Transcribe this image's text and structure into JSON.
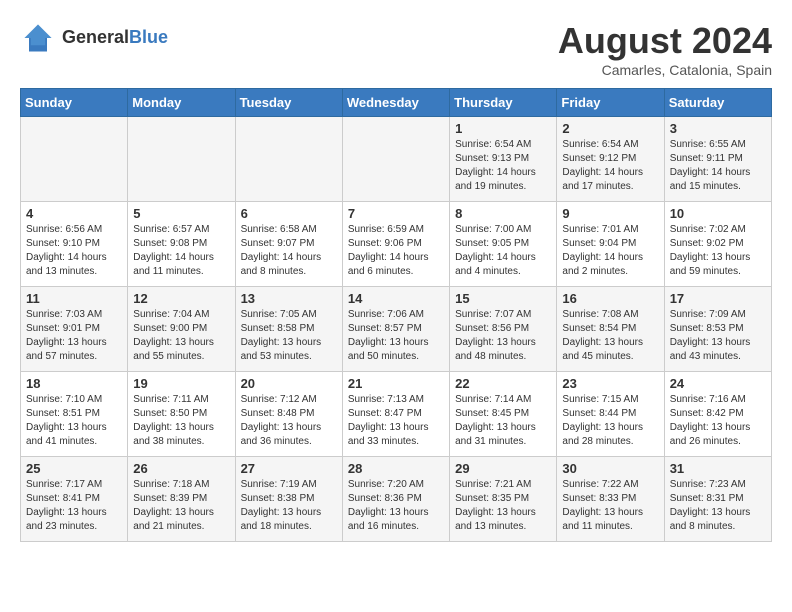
{
  "header": {
    "logo": {
      "general": "General",
      "blue": "Blue"
    },
    "title": "August 2024",
    "location": "Camarles, Catalonia, Spain"
  },
  "days_of_week": [
    "Sunday",
    "Monday",
    "Tuesday",
    "Wednesday",
    "Thursday",
    "Friday",
    "Saturday"
  ],
  "weeks": [
    [
      {
        "day": "",
        "info": ""
      },
      {
        "day": "",
        "info": ""
      },
      {
        "day": "",
        "info": ""
      },
      {
        "day": "",
        "info": ""
      },
      {
        "day": "1",
        "info": "Sunrise: 6:54 AM\nSunset: 9:13 PM\nDaylight: 14 hours\nand 19 minutes."
      },
      {
        "day": "2",
        "info": "Sunrise: 6:54 AM\nSunset: 9:12 PM\nDaylight: 14 hours\nand 17 minutes."
      },
      {
        "day": "3",
        "info": "Sunrise: 6:55 AM\nSunset: 9:11 PM\nDaylight: 14 hours\nand 15 minutes."
      }
    ],
    [
      {
        "day": "4",
        "info": "Sunrise: 6:56 AM\nSunset: 9:10 PM\nDaylight: 14 hours\nand 13 minutes."
      },
      {
        "day": "5",
        "info": "Sunrise: 6:57 AM\nSunset: 9:08 PM\nDaylight: 14 hours\nand 11 minutes."
      },
      {
        "day": "6",
        "info": "Sunrise: 6:58 AM\nSunset: 9:07 PM\nDaylight: 14 hours\nand 8 minutes."
      },
      {
        "day": "7",
        "info": "Sunrise: 6:59 AM\nSunset: 9:06 PM\nDaylight: 14 hours\nand 6 minutes."
      },
      {
        "day": "8",
        "info": "Sunrise: 7:00 AM\nSunset: 9:05 PM\nDaylight: 14 hours\nand 4 minutes."
      },
      {
        "day": "9",
        "info": "Sunrise: 7:01 AM\nSunset: 9:04 PM\nDaylight: 14 hours\nand 2 minutes."
      },
      {
        "day": "10",
        "info": "Sunrise: 7:02 AM\nSunset: 9:02 PM\nDaylight: 13 hours\nand 59 minutes."
      }
    ],
    [
      {
        "day": "11",
        "info": "Sunrise: 7:03 AM\nSunset: 9:01 PM\nDaylight: 13 hours\nand 57 minutes."
      },
      {
        "day": "12",
        "info": "Sunrise: 7:04 AM\nSunset: 9:00 PM\nDaylight: 13 hours\nand 55 minutes."
      },
      {
        "day": "13",
        "info": "Sunrise: 7:05 AM\nSunset: 8:58 PM\nDaylight: 13 hours\nand 53 minutes."
      },
      {
        "day": "14",
        "info": "Sunrise: 7:06 AM\nSunset: 8:57 PM\nDaylight: 13 hours\nand 50 minutes."
      },
      {
        "day": "15",
        "info": "Sunrise: 7:07 AM\nSunset: 8:56 PM\nDaylight: 13 hours\nand 48 minutes."
      },
      {
        "day": "16",
        "info": "Sunrise: 7:08 AM\nSunset: 8:54 PM\nDaylight: 13 hours\nand 45 minutes."
      },
      {
        "day": "17",
        "info": "Sunrise: 7:09 AM\nSunset: 8:53 PM\nDaylight: 13 hours\nand 43 minutes."
      }
    ],
    [
      {
        "day": "18",
        "info": "Sunrise: 7:10 AM\nSunset: 8:51 PM\nDaylight: 13 hours\nand 41 minutes."
      },
      {
        "day": "19",
        "info": "Sunrise: 7:11 AM\nSunset: 8:50 PM\nDaylight: 13 hours\nand 38 minutes."
      },
      {
        "day": "20",
        "info": "Sunrise: 7:12 AM\nSunset: 8:48 PM\nDaylight: 13 hours\nand 36 minutes."
      },
      {
        "day": "21",
        "info": "Sunrise: 7:13 AM\nSunset: 8:47 PM\nDaylight: 13 hours\nand 33 minutes."
      },
      {
        "day": "22",
        "info": "Sunrise: 7:14 AM\nSunset: 8:45 PM\nDaylight: 13 hours\nand 31 minutes."
      },
      {
        "day": "23",
        "info": "Sunrise: 7:15 AM\nSunset: 8:44 PM\nDaylight: 13 hours\nand 28 minutes."
      },
      {
        "day": "24",
        "info": "Sunrise: 7:16 AM\nSunset: 8:42 PM\nDaylight: 13 hours\nand 26 minutes."
      }
    ],
    [
      {
        "day": "25",
        "info": "Sunrise: 7:17 AM\nSunset: 8:41 PM\nDaylight: 13 hours\nand 23 minutes."
      },
      {
        "day": "26",
        "info": "Sunrise: 7:18 AM\nSunset: 8:39 PM\nDaylight: 13 hours\nand 21 minutes."
      },
      {
        "day": "27",
        "info": "Sunrise: 7:19 AM\nSunset: 8:38 PM\nDaylight: 13 hours\nand 18 minutes."
      },
      {
        "day": "28",
        "info": "Sunrise: 7:20 AM\nSunset: 8:36 PM\nDaylight: 13 hours\nand 16 minutes."
      },
      {
        "day": "29",
        "info": "Sunrise: 7:21 AM\nSunset: 8:35 PM\nDaylight: 13 hours\nand 13 minutes."
      },
      {
        "day": "30",
        "info": "Sunrise: 7:22 AM\nSunset: 8:33 PM\nDaylight: 13 hours\nand 11 minutes."
      },
      {
        "day": "31",
        "info": "Sunrise: 7:23 AM\nSunset: 8:31 PM\nDaylight: 13 hours\nand 8 minutes."
      }
    ]
  ]
}
